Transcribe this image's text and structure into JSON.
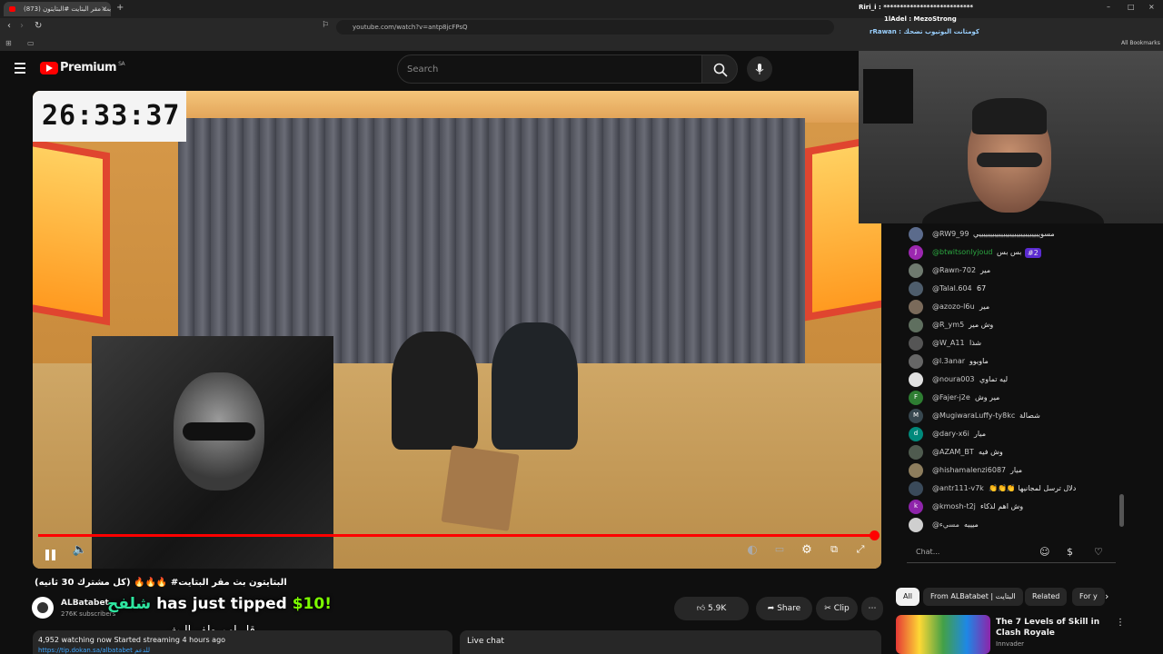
{
  "browser": {
    "tab_title": "(873) بث مقر البتايت #البتايتون",
    "url": "youtube.com/watch?v=antp8jcFPsQ",
    "all_bookmarks": "All Bookmarks"
  },
  "overlay": {
    "line1": "Riri_i : ***************************",
    "line2": "1lAdel : MezoStrong",
    "line3": "rRawan : كومتانت اليوتيوب تضحك"
  },
  "header": {
    "brand": "Premium",
    "region": "SA",
    "search_placeholder": "Search"
  },
  "video": {
    "timer": "26:33:37"
  },
  "tip": {
    "name": "شلفح",
    "text": "has just tipped",
    "amount": "$10!",
    "message": "قل لهم طفو البث"
  },
  "below": {
    "title": "(كل مشترك 30 ثانيه) 🔥🔥🔥 #البتايتون بث مقر البتايت",
    "channel": "ALBatabet",
    "subs": "276K subscribers",
    "likes": "5.9K",
    "share": "Share",
    "clip": "Clip",
    "stats": "4,952 watching now  Started streaming 4 hours ago",
    "link": "https://tip.dokan.sa/albatabet للدعم",
    "live_chat": "Live chat"
  },
  "chat": {
    "messages": [
      {
        "user": "@RW9_99",
        "text": "مسوييييييييييييييييييييييييييييي",
        "color": "#5b6b8c",
        "initial": ""
      },
      {
        "user": "@btwitsonlyjoud",
        "text": "بس بس",
        "color": "#9c27b0",
        "initial": "J",
        "highlight": true,
        "badge": "#2"
      },
      {
        "user": "@Rawn-702",
        "text": "مير",
        "color": "#6f7a6f",
        "initial": ""
      },
      {
        "user": "@Talal.604",
        "text": "67",
        "color": "#4e5d6c",
        "initial": ""
      },
      {
        "user": "@azozo-l6u",
        "text": "مير",
        "color": "#7a6a5a",
        "initial": ""
      },
      {
        "user": "@R_ym5",
        "text": "وش مير",
        "color": "#5f6f5f",
        "initial": ""
      },
      {
        "user": "@W_A11",
        "text": "شذا",
        "color": "#555555",
        "initial": ""
      },
      {
        "user": "@l.3anar",
        "text": "ماويوو",
        "color": "#666666",
        "initial": ""
      },
      {
        "user": "@noura003",
        "text": "ليه تماوي",
        "color": "#e0e0e0",
        "initial": ""
      },
      {
        "user": "@Fajer-j2e",
        "text": "مير وش",
        "color": "#2e7d32",
        "initial": "F"
      },
      {
        "user": "@MugiwaraLuffy-ty8kc",
        "text": "شصالة",
        "color": "#37474f",
        "initial": "M"
      },
      {
        "user": "@dary-x6i",
        "text": "ميار",
        "color": "#00897b",
        "initial": "d"
      },
      {
        "user": "@AZAM_BT",
        "text": "وش فيه",
        "color": "#4f5b4f",
        "initial": ""
      },
      {
        "user": "@hishamalenzi6087",
        "text": "ميار",
        "color": "#8d7d5d",
        "initial": ""
      },
      {
        "user": "@antr111-v7k",
        "text": "👏👏👏 دلال ترسل لمجانيها",
        "color": "#3a4a5a",
        "initial": ""
      },
      {
        "user": "@kmosh-t2j",
        "text": "وش اهم لذكاء",
        "color": "#8e24aa",
        "initial": "k"
      },
      {
        "user": "@مسيء",
        "text": "ميييه",
        "color": "#cfcfcf",
        "initial": ""
      }
    ],
    "input_placeholder": "Chat..."
  },
  "chips": [
    "All",
    "From ALBatabet | البتايت",
    "Related",
    "For y"
  ],
  "related": {
    "title": "The 7 Levels of Skill in Clash Royale",
    "channel": "Innvader"
  }
}
